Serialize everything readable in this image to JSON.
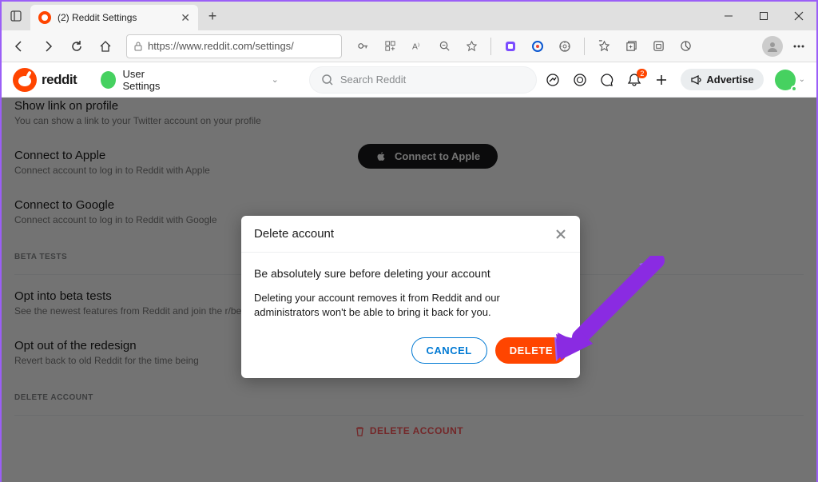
{
  "browser": {
    "tab_title": "(2) Reddit Settings",
    "url": "https://www.reddit.com/settings/"
  },
  "reddit_header": {
    "brand": "reddit",
    "dropdown_label": "User Settings",
    "search_placeholder": "Search Reddit",
    "notification_count": "2",
    "advertise_label": "Advertise"
  },
  "settings": {
    "row0_title": "Show link on profile",
    "row0_desc": "You can show a link to your Twitter account on your profile",
    "apple_title": "Connect to Apple",
    "apple_desc": "Connect account to log in to Reddit with Apple",
    "apple_button": "Connect to Apple",
    "google_title": "Connect to Google",
    "google_desc": "Connect account to log in to Reddit with Google",
    "section_beta": "BETA TESTS",
    "beta_title": "Opt into beta tests",
    "beta_desc": "See the newest features from Reddit and join the r/beta community",
    "redesign_title": "Opt out of the redesign",
    "redesign_desc": "Revert back to old Reddit for the time being",
    "section_delete": "DELETE ACCOUNT",
    "delete_link": "DELETE ACCOUNT"
  },
  "modal": {
    "title": "Delete account",
    "subhead": "Be absolutely sure before deleting your account",
    "body": "Deleting your account removes it from Reddit and our administrators won't be able to bring it back for you.",
    "cancel": "CANCEL",
    "delete": "DELETE"
  },
  "colors": {
    "accent": "#ff4500",
    "link": "#0079d3",
    "arrow": "#8a2be2"
  }
}
